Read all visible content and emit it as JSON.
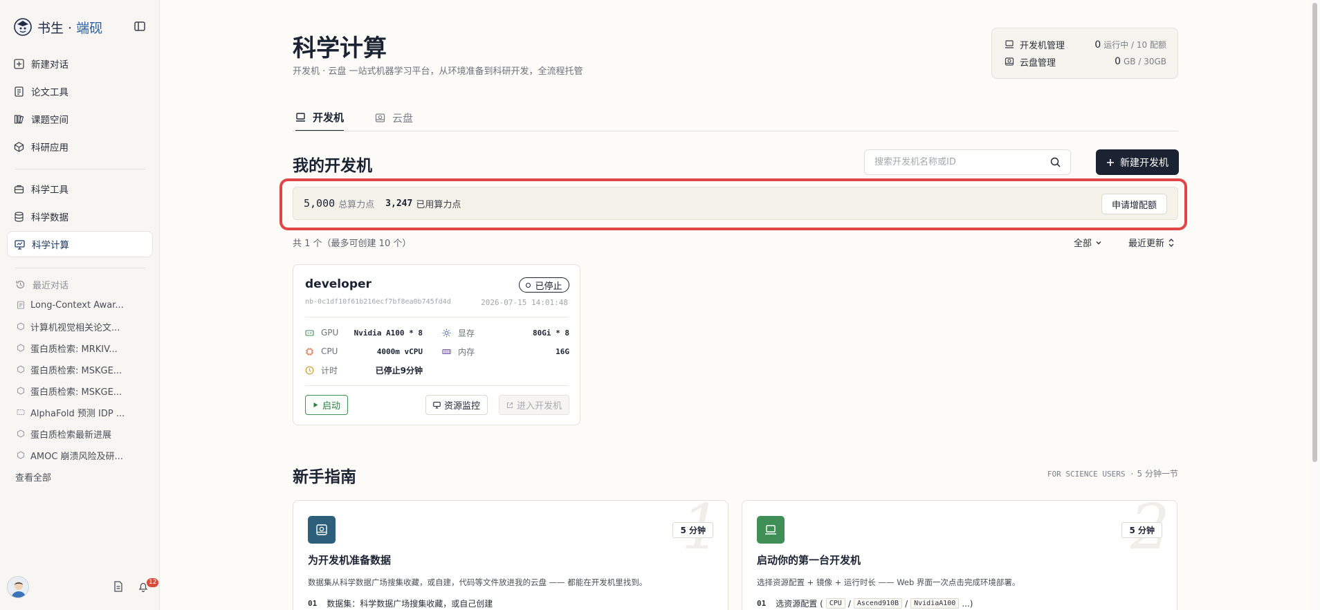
{
  "app": {
    "logo_text": "书生 ·",
    "logo_accent": " 端砚"
  },
  "sidebar": {
    "nav": [
      {
        "label": "新建对话"
      },
      {
        "label": "论文工具"
      },
      {
        "label": "课题空间"
      },
      {
        "label": "科研应用"
      },
      {
        "label": "科学工具"
      },
      {
        "label": "科学数据"
      },
      {
        "label": "科学计算"
      }
    ],
    "recent_header": "最近对话",
    "recent": [
      "Long-Context Awar...",
      "计算机视觉相关论文...",
      "蛋白质检索: MRKIV...",
      "蛋白质检索: MSKGE...",
      "蛋白质检索: MSKGE...",
      "AlphaFold 预测 IDP ...",
      "蛋白质检索最新进展",
      "AMOC 崩溃风险及研..."
    ],
    "view_all": "查看全部",
    "notification_count": "12"
  },
  "header": {
    "title": "科学计算",
    "subtitle": "开发机 · 云盘 一站式机器学习平台，从环境准备到科研开发，全流程托管",
    "stats": [
      {
        "label": "开发机管理",
        "value": "0",
        "unit": "运行中 / 10 配额"
      },
      {
        "label": "云盘管理",
        "value": "0",
        "unit": "GB / 30GB"
      }
    ]
  },
  "tabs": [
    {
      "label": "开发机"
    },
    {
      "label": "云盘"
    }
  ],
  "machines": {
    "title": "我的开发机",
    "search_placeholder": "搜索开发机名称或ID",
    "new_button": "新建开发机",
    "quota": {
      "total": "5,000",
      "total_label": "总算力点",
      "used": "3,247",
      "used_label": "已用算力点",
      "button": "申请增配额"
    },
    "count_text": "共 1 个（最多可创建 10 个）",
    "filter_all": "全部",
    "sort": "最近更新",
    "cards": [
      {
        "name": "developer",
        "status": "已停止",
        "id": "nb-0c1df10f61b216ecf7bf8ea0b745fd4d",
        "time": "2026-07-15 14:01:48",
        "gpu_label": "GPU",
        "gpu": "Nvidia A100 * 8",
        "vram_label": "显存",
        "vram": "80Gi * 8",
        "cpu_label": "CPU",
        "cpu": "4000m vCPU",
        "mem_label": "内存",
        "mem": "16G",
        "timer_label": "计时",
        "timer": "已停止9分钟",
        "start": "启动",
        "monitor": "资源监控",
        "enter": "进入开发机"
      }
    ]
  },
  "guide": {
    "title": "新手指南",
    "meta_en": "FOR SCIENCE USERS ·",
    "meta_cn": " 5 分钟一节",
    "cards": [
      {
        "num": "1",
        "badge": "5 分钟",
        "title": "为开发机准备数据",
        "desc": "数据集从科学数据广场搜集收藏，或自建，代码等文件放进我的云盘 —— 都能在开发机里找到。",
        "step_no": "01",
        "step": "数据集：科学数据广场搜集收藏，或自己创建"
      },
      {
        "num": "2",
        "badge": "5 分钟",
        "title": "启动你的第一台开发机",
        "desc": "选择资源配置 + 镜像 + 运行时长 —— Web 界面一次点击完成环境部署。",
        "step_no": "01",
        "step": "选资源配置 (",
        "chip1": "CPU",
        "chip2": "Ascend910B",
        "chip3": "NvidiaA100",
        "step_tail": "...)"
      }
    ]
  }
}
